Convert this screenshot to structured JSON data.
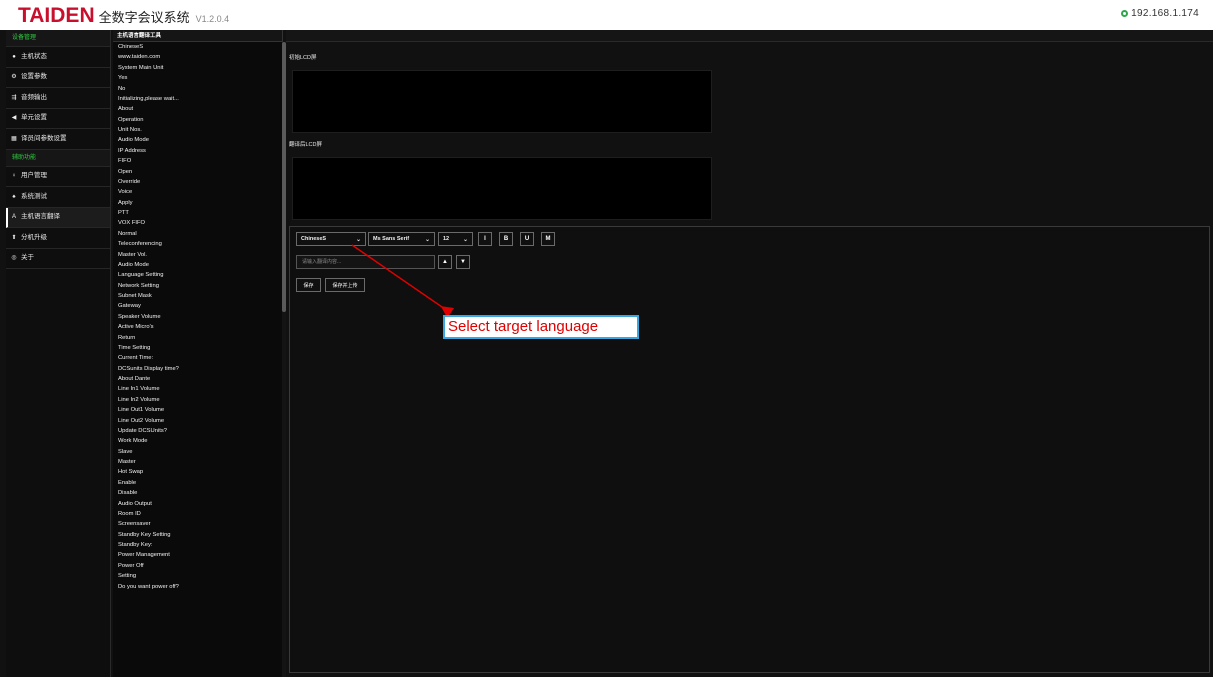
{
  "header": {
    "logo": "TAIDEN",
    "app_title": "全数字会议系统",
    "version": "V1.2.0.4",
    "ip": "192.168.1.174"
  },
  "sidebar": {
    "groups": [
      {
        "label": "设备管理",
        "items": [
          {
            "label": "主机状态",
            "icon": "circle-dot-icon"
          },
          {
            "label": "设置参数",
            "icon": "settings-icon"
          },
          {
            "label": "音频输出",
            "icon": "output-icon"
          },
          {
            "label": "单元设置",
            "icon": "speaker-icon"
          },
          {
            "label": "译员间参数设置",
            "icon": "booth-icon"
          }
        ]
      },
      {
        "label": "辅助功能",
        "items": [
          {
            "label": "用户管理",
            "icon": "user-pin-icon"
          },
          {
            "label": "系统测试",
            "icon": "test-icon"
          },
          {
            "label": "主机语言翻译",
            "icon": "translate-icon",
            "active": true
          },
          {
            "label": "分机升级",
            "icon": "upload-icon"
          },
          {
            "label": "关于",
            "icon": "about-icon"
          }
        ]
      }
    ]
  },
  "list_panel": {
    "header": "主机语言翻译工具",
    "items": [
      "ChineseS",
      "www.taiden.com",
      "System Main Unit",
      "Yes",
      "No",
      "Initializing,please wait...",
      "About",
      "Operation",
      "Unit Nos.",
      "Audio Mode",
      "IP Address",
      "FIFO",
      "Open",
      "Override",
      "Voice",
      "Apply",
      "PTT",
      "VOX FIFO",
      "Normal",
      "Teleconferencing",
      "Master Vol.",
      "Audio Mode",
      "Language Setting",
      "Network Setting",
      "Subnet Mask",
      "Gateway",
      "Speaker Volume",
      "Active Micro's",
      "Return",
      "Time Setting",
      "Current Time:",
      "DCSunits Display time?",
      "About Dante",
      "Line In1 Volume",
      "Line In2 Volume",
      "Line Out1 Volume",
      "Line Out2 Volume",
      "Update DCSUnits?",
      "Work Mode",
      "Slave",
      "Master",
      "Hot Swap",
      "Enable",
      "Disable",
      "Audio Output",
      "Room ID",
      "Screensaver",
      "Standby Key Setting",
      "Standby Key:",
      "Power Management",
      "Power Off",
      "Setting",
      "Do you want power off?"
    ]
  },
  "main": {
    "source_lcd_label": "初始LCD屏",
    "target_lcd_label": "翻译后LCD屏",
    "language_select": "ChineseS",
    "font_select": "Ms Sans Serif",
    "size_select": "12",
    "format_buttons": [
      "I",
      "B",
      "U",
      "M"
    ],
    "input_placeholder": "请输入翻译内容...",
    "up_arrow": "▲",
    "down_arrow": "▼",
    "save_label": "保存",
    "save_upload_label": "保存并上传"
  },
  "annotation": {
    "callout_text": "Select target language",
    "arrow_color": "#e00000",
    "border_color": "#3aa6e0"
  },
  "colors": {
    "brand": "#c8102e",
    "group_green": "#2ecc40",
    "ip_green": "#2aa84a",
    "panel_bg": "#111111"
  }
}
